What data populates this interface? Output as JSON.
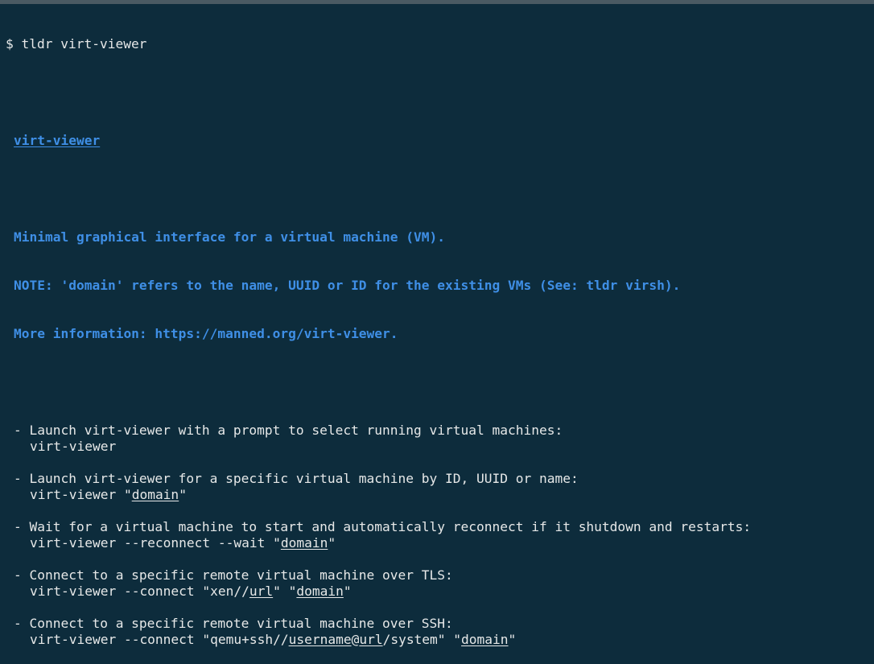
{
  "prompt": {
    "symbol": "$",
    "command": "tldr virt-viewer"
  },
  "page": {
    "title": "virt-viewer",
    "description": [
      "Minimal graphical interface for a virtual machine (VM).",
      "NOTE: 'domain' refers to the name, UUID or ID for the existing VMs (See: tldr virsh).",
      "More information: https://manned.org/virt-viewer."
    ],
    "accent_color": "#3f8fe6",
    "background_color": "#0d2c3c",
    "text_color": "#e6e8e8"
  },
  "examples": [
    {
      "description": "- Launch virt-viewer with a prompt to select running virtual machines:",
      "command_parts": [
        {
          "text": "virt-viewer",
          "placeholder": false
        }
      ]
    },
    {
      "description": "- Launch virt-viewer for a specific virtual machine by ID, UUID or name:",
      "command_parts": [
        {
          "text": "virt-viewer \"",
          "placeholder": false
        },
        {
          "text": "domain",
          "placeholder": true
        },
        {
          "text": "\"",
          "placeholder": false
        }
      ]
    },
    {
      "description": "- Wait for a virtual machine to start and automatically reconnect if it shutdown and restarts:",
      "command_parts": [
        {
          "text": "virt-viewer --reconnect --wait \"",
          "placeholder": false
        },
        {
          "text": "domain",
          "placeholder": true
        },
        {
          "text": "\"",
          "placeholder": false
        }
      ]
    },
    {
      "description": "- Connect to a specific remote virtual machine over TLS:",
      "command_parts": [
        {
          "text": "virt-viewer --connect \"xen//",
          "placeholder": false
        },
        {
          "text": "url",
          "placeholder": true
        },
        {
          "text": "\" \"",
          "placeholder": false
        },
        {
          "text": "domain",
          "placeholder": true
        },
        {
          "text": "\"",
          "placeholder": false
        }
      ]
    },
    {
      "description": "- Connect to a specific remote virtual machine over SSH:",
      "command_parts": [
        {
          "text": "virt-viewer --connect \"qemu+ssh//",
          "placeholder": false
        },
        {
          "text": "username",
          "placeholder": true
        },
        {
          "text": "@",
          "placeholder": false
        },
        {
          "text": "url",
          "placeholder": true
        },
        {
          "text": "/system\" \"",
          "placeholder": false
        },
        {
          "text": "domain",
          "placeholder": true
        },
        {
          "text": "\"",
          "placeholder": false
        }
      ]
    }
  ]
}
